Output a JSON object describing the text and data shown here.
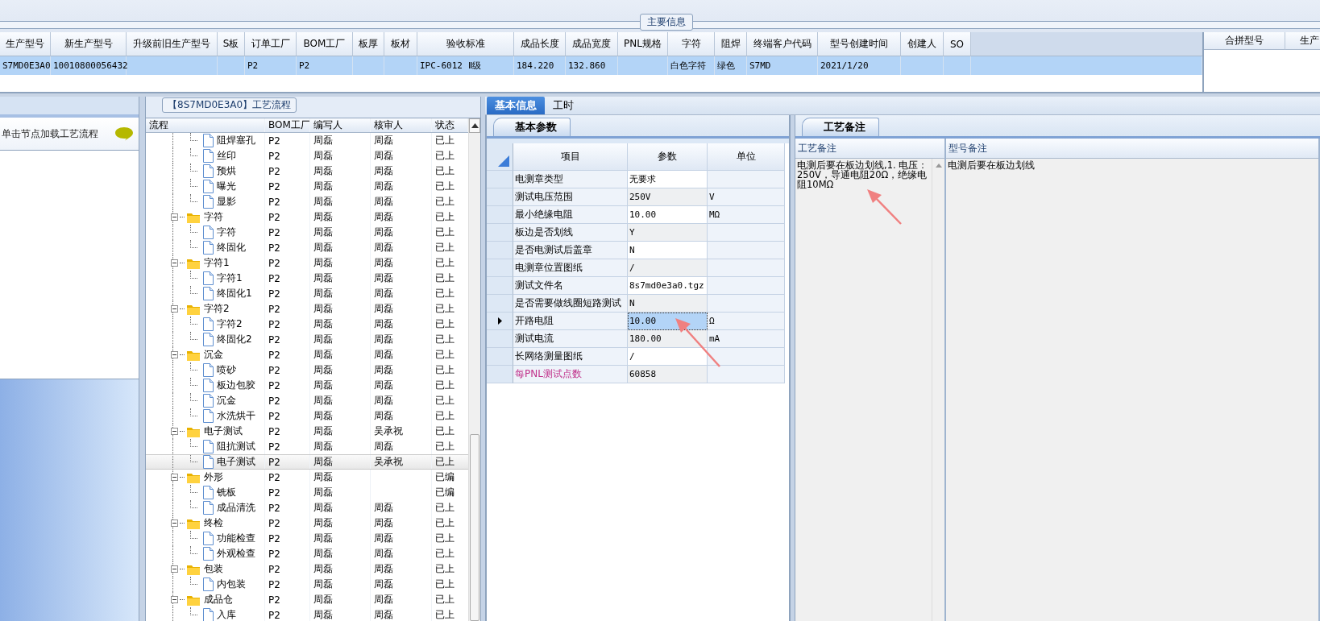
{
  "main_info": {
    "title": "主要信息",
    "columns": [
      "生产型号",
      "新生产型号",
      "升级前旧生产型号",
      "S板",
      "订单工厂",
      "BOM工厂",
      "板厚",
      "板材",
      "验收标准",
      "成品长度",
      "成品宽度",
      "PNL规格",
      "字符",
      "阻焊",
      "终端客户代码",
      "型号创建时间",
      "创建人",
      "SO"
    ],
    "rows": [
      {
        "selected": true,
        "cells": [
          "S7MD0E3A0",
          "10010800056432",
          null,
          null,
          "P2",
          "P2",
          null,
          null,
          "IPC-6012 Ⅱ级",
          "184.220",
          "132.860",
          null,
          "白色字符",
          "绿色",
          "S7MD",
          "2021/1/20",
          null,
          null
        ]
      }
    ]
  },
  "merge_panel": {
    "columns": [
      "合拼型号",
      "生产"
    ]
  },
  "hint_panel": {
    "text": "单击节点加载工艺流程"
  },
  "process_flow": {
    "title": "【8S7MD0E3A0】工艺流程",
    "columns": [
      "流程",
      "BOM工厂",
      "编写人",
      "核审人",
      "状态"
    ],
    "rows": [
      {
        "kind": "step",
        "name": "阻焊塞孔",
        "bom": "P2",
        "writer": "周磊",
        "reviewer": "周磊",
        "status": "已上",
        "selected": false
      },
      {
        "kind": "step",
        "name": "丝印",
        "bom": "P2",
        "writer": "周磊",
        "reviewer": "周磊",
        "status": "已上",
        "selected": false
      },
      {
        "kind": "step",
        "name": "预烘",
        "bom": "P2",
        "writer": "周磊",
        "reviewer": "周磊",
        "status": "已上",
        "selected": false
      },
      {
        "kind": "step",
        "name": "曝光",
        "bom": "P2",
        "writer": "周磊",
        "reviewer": "周磊",
        "status": "已上",
        "selected": false
      },
      {
        "kind": "step",
        "name": "显影",
        "bom": "P2",
        "writer": "周磊",
        "reviewer": "周磊",
        "status": "已上",
        "selected": false
      },
      {
        "kind": "folder",
        "name": "字符",
        "bom": "P2",
        "writer": "周磊",
        "reviewer": "周磊",
        "status": "已上",
        "selected": false,
        "expanded": true,
        "children": [
          {
            "kind": "step",
            "name": "字符",
            "bom": "P2",
            "writer": "周磊",
            "reviewer": "周磊",
            "status": "已上",
            "selected": false
          },
          {
            "kind": "step",
            "name": "终固化",
            "bom": "P2",
            "writer": "周磊",
            "reviewer": "周磊",
            "status": "已上",
            "selected": false
          }
        ]
      },
      {
        "kind": "folder",
        "name": "字符1",
        "bom": "P2",
        "writer": "周磊",
        "reviewer": "周磊",
        "status": "已上",
        "selected": false,
        "expanded": true,
        "children": [
          {
            "kind": "step",
            "name": "字符1",
            "bom": "P2",
            "writer": "周磊",
            "reviewer": "周磊",
            "status": "已上",
            "selected": false
          },
          {
            "kind": "step",
            "name": "终固化1",
            "bom": "P2",
            "writer": "周磊",
            "reviewer": "周磊",
            "status": "已上",
            "selected": false
          }
        ]
      },
      {
        "kind": "folder",
        "name": "字符2",
        "bom": "P2",
        "writer": "周磊",
        "reviewer": "周磊",
        "status": "已上",
        "selected": false,
        "expanded": true,
        "children": [
          {
            "kind": "step",
            "name": "字符2",
            "bom": "P2",
            "writer": "周磊",
            "reviewer": "周磊",
            "status": "已上",
            "selected": false
          },
          {
            "kind": "step",
            "name": "终固化2",
            "bom": "P2",
            "writer": "周磊",
            "reviewer": "周磊",
            "status": "已上",
            "selected": false
          }
        ]
      },
      {
        "kind": "folder",
        "name": "沉金",
        "bom": "P2",
        "writer": "周磊",
        "reviewer": "周磊",
        "status": "已上",
        "selected": false,
        "expanded": true,
        "children": [
          {
            "kind": "step",
            "name": "喷砂",
            "bom": "P2",
            "writer": "周磊",
            "reviewer": "周磊",
            "status": "已上",
            "selected": false
          },
          {
            "kind": "step",
            "name": "板边包胶",
            "bom": "P2",
            "writer": "周磊",
            "reviewer": "周磊",
            "status": "已上",
            "selected": false
          },
          {
            "kind": "step",
            "name": "沉金",
            "bom": "P2",
            "writer": "周磊",
            "reviewer": "周磊",
            "status": "已上",
            "selected": false
          },
          {
            "kind": "step",
            "name": "水洗烘干",
            "bom": "P2",
            "writer": "周磊",
            "reviewer": "周磊",
            "status": "已上",
            "selected": false
          }
        ]
      },
      {
        "kind": "folder",
        "name": "电子测试",
        "bom": "P2",
        "writer": "周磊",
        "reviewer": "吴承祝",
        "status": "已上",
        "selected": false,
        "expanded": true,
        "children": [
          {
            "kind": "step",
            "name": "阻抗测试",
            "bom": "P2",
            "writer": "周磊",
            "reviewer": "周磊",
            "status": "已上",
            "selected": false
          },
          {
            "kind": "step",
            "name": "电子测试",
            "bom": "P2",
            "writer": "周磊",
            "reviewer": "吴承祝",
            "status": "已上",
            "selected": true
          }
        ]
      },
      {
        "kind": "folder",
        "name": "外形",
        "bom": "P2",
        "writer": "周磊",
        "status": "已编",
        "selected": false,
        "expanded": true,
        "children": [
          {
            "kind": "step",
            "name": "铣板",
            "bom": "P2",
            "writer": "周磊",
            "status": "已编",
            "selected": false
          },
          {
            "kind": "step",
            "name": "成品清洗",
            "bom": "P2",
            "writer": "周磊",
            "reviewer": "周磊",
            "status": "已上",
            "selected": false
          }
        ]
      },
      {
        "kind": "folder",
        "name": "终检",
        "bom": "P2",
        "writer": "周磊",
        "reviewer": "周磊",
        "status": "已上",
        "selected": false,
        "expanded": true,
        "children": [
          {
            "kind": "step",
            "name": "功能检查",
            "bom": "P2",
            "writer": "周磊",
            "reviewer": "周磊",
            "status": "已上",
            "selected": false
          },
          {
            "kind": "step",
            "name": "外观检查",
            "bom": "P2",
            "writer": "周磊",
            "reviewer": "周磊",
            "status": "已上",
            "selected": false
          }
        ]
      },
      {
        "kind": "folder",
        "name": "包装",
        "bom": "P2",
        "writer": "周磊",
        "reviewer": "周磊",
        "status": "已上",
        "selected": false,
        "expanded": true,
        "children": [
          {
            "kind": "step",
            "name": "内包装",
            "bom": "P2",
            "writer": "周磊",
            "reviewer": "周磊",
            "status": "已上",
            "selected": false
          }
        ]
      },
      {
        "kind": "folder",
        "name": "成品仓",
        "bom": "P2",
        "writer": "周磊",
        "reviewer": "周磊",
        "status": "已上",
        "selected": false,
        "expanded": true,
        "children": [
          {
            "kind": "step",
            "name": "入库",
            "bom": "P2",
            "writer": "周磊",
            "reviewer": "周磊",
            "status": "已上",
            "selected": false
          }
        ]
      }
    ]
  },
  "detail_tabs": [
    {
      "label": "基本信息",
      "selected": true
    },
    {
      "label": "工时",
      "selected": false
    }
  ],
  "params": {
    "tab": "基本参数",
    "columns": [
      "项目",
      "参数",
      "单位"
    ],
    "rows": [
      {
        "item": "电测章类型",
        "value": "无要求",
        "selected": false
      },
      {
        "item": "测试电压范围",
        "value": "250V",
        "unit": "V",
        "selected": false
      },
      {
        "item": "最小绝缘电阻",
        "value": "10.00",
        "unit": "MΩ",
        "selected": false
      },
      {
        "item": "板边是否划线",
        "value": "Y",
        "selected": false
      },
      {
        "item": "是否电测试后盖章",
        "value": "N",
        "selected": false
      },
      {
        "item": "电测章位置图纸",
        "value": "/",
        "selected": false
      },
      {
        "item": "测试文件名",
        "value": "8s7md0e3a0.tgz",
        "selected": false
      },
      {
        "item": "是否需要做线圈短路测试",
        "value": "N",
        "selected": false
      },
      {
        "item": "开路电阻",
        "value": "10.00",
        "unit": "Ω",
        "selected": true
      },
      {
        "item": "测试电流",
        "value": "180.00",
        "unit": "mA",
        "selected": false
      },
      {
        "item": "长网络测量图纸",
        "value": "/",
        "selected": false
      },
      {
        "item": "每PNL测试点数",
        "value": "60858",
        "selected": false,
        "color": "#c0308a"
      }
    ]
  },
  "notes": {
    "tab": "工艺备注",
    "columns": [
      {
        "label": "工艺备注",
        "text": "电测后要在板边划线,1.   电压：250V，导通电阻20Ω，绝缘电阻10MΩ"
      },
      {
        "label": "型号备注",
        "text": "电测后要在板边划线"
      }
    ]
  }
}
